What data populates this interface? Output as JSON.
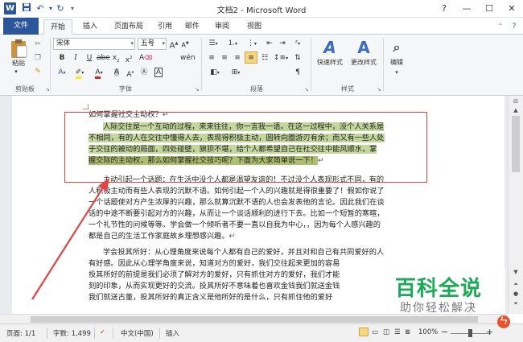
{
  "window": {
    "title": "文档2 - Microsoft Word",
    "app_icon": "W",
    "quick_access": [
      "save-icon",
      "undo-icon",
      "redo-icon",
      "customize-icon"
    ],
    "controls": {
      "help": "?",
      "minimize": "—",
      "maximize": "☐",
      "close": "✕"
    }
  },
  "tabs": [
    {
      "label": "文件",
      "active": false,
      "file": true
    },
    {
      "label": "开始",
      "active": true
    },
    {
      "label": "插入",
      "active": false
    },
    {
      "label": "页面布局",
      "active": false
    },
    {
      "label": "引用",
      "active": false
    },
    {
      "label": "邮件",
      "active": false
    },
    {
      "label": "审阅",
      "active": false
    },
    {
      "label": "视图",
      "active": false
    }
  ],
  "ribbon": {
    "clipboard": {
      "paste_label": "粘贴",
      "group_label": "剪贴板"
    },
    "font": {
      "font_name": "宋体",
      "font_size": "五号",
      "size_unit": "wén",
      "group_label": "字体"
    },
    "paragraph": {
      "group_label": "段落"
    },
    "styles": {
      "quick_styles_label": "快速样式",
      "change_styles_label": "更改样式",
      "group_label": "样式"
    },
    "editing": {
      "label": "编辑"
    }
  },
  "document": {
    "lines": [
      {
        "text": "如何掌握社交主动权？",
        "highlight": false
      },
      {
        "text": "人际交往是一个互动的过程，来来往往，你一言我一语。在这一过程中，没个人关系是",
        "highlight": true
      },
      {
        "text": "不相同，有的人在交往中懂得人去，表现得积极主动，圆转向圈游刃有余；而又有一些人处",
        "highlight": true
      },
      {
        "text": "于交往的被动的局面，四处碰壁，狼狈不堪，给个人都希望自己在社交往中能风顺水，掌",
        "highlight": true
      },
      {
        "text": "握交际的主动权，那么如何掌握社交技巧呢？下面为大家简单说一下！",
        "highlight": true
      },
      {
        "text": "主动引起一个话题：在生活中没个人都是渴望友谊的！不过没个人表现形式不同，有的",
        "highlight": false
      },
      {
        "text": "人积极主动而有些人表现的沉默不语。如何引起一个人的兴趣就是得很重要了！假如你说了",
        "highlight": false
      },
      {
        "text": "一个话题使对方产生浓厚的兴趣，那么就算沉默不语的人也会发表他的言论。因此我们在谈",
        "highlight": false
      },
      {
        "text": "话的中途不断要引起对方的兴趣，从而让一个谈话顺利的进行下去。比如一个短暂的寒暄，",
        "highlight": false
      },
      {
        "text": "一个礼节性的问候等等。学会做一个倾听者不要一直以自我为中心，，因为每个人感兴趣的",
        "highlight": false
      },
      {
        "text": "都是自己的生活工作家庭故乡理想感兴趣。",
        "highlight": false
      },
      {
        "text": "学会投其所好：从心理角度来说每个人都有自己的爱好，并且对和自己有共同爱好的人",
        "highlight": false
      },
      {
        "text": "有好感。因此从心理学角度来说，知道对方的爱好，我们交往起来更加的容易",
        "highlight": false
      },
      {
        "text": "投其所好的前提是我们必须了解对方的爱好，只有抓住对方的爱好，我们才能",
        "highlight": false
      },
      {
        "text": "刻的印象，从而实现更好的交流。投其所好不意味着也喜欢金钱我们就送金钱",
        "highlight": false
      },
      {
        "text": "我们就送古董，投其所好的真正含义是他所好的是什么，只有抓住他的爱好",
        "highlight": false
      }
    ]
  },
  "statusbar": {
    "page": "页面: 1/1",
    "words": "字数: 1,499",
    "language": "中文(中国)",
    "mode": "插入",
    "zoom": "100%",
    "zoom_minus": "−",
    "zoom_plus": "+"
  },
  "watermark": {
    "title": "百科全说",
    "subtitle": "助你轻松解决",
    "logo_char": "ㄣ"
  },
  "colors": {
    "accent": "#2b579a",
    "highlight": "#c3d69b",
    "annotation": "#e04545",
    "watermark_green": "#1aaa55"
  }
}
